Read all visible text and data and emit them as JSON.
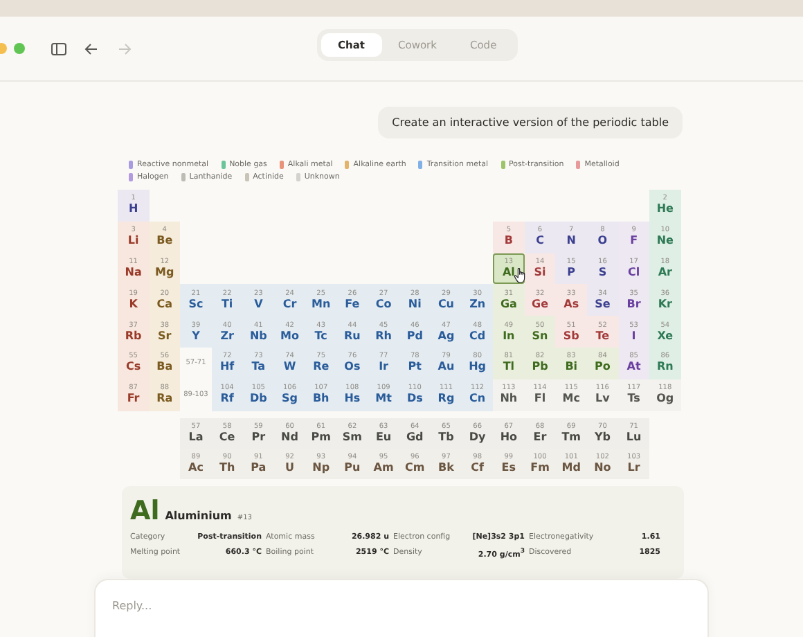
{
  "toolbar": {
    "tabs": [
      {
        "label": "Chat",
        "selected": true
      },
      {
        "label": "Cowork",
        "selected": false
      },
      {
        "label": "Code",
        "selected": false
      }
    ],
    "forward_disabled": true
  },
  "message": "Create an interactive version of the periodic table",
  "legend": [
    {
      "kind": "nonmetal",
      "label": "Reactive nonmetal",
      "color": "#a99be0"
    },
    {
      "kind": "noble",
      "label": "Noble gas",
      "color": "#6cc49a"
    },
    {
      "kind": "alkali",
      "label": "Alkali metal",
      "color": "#e8937a"
    },
    {
      "kind": "alkaline",
      "label": "Alkaline earth",
      "color": "#e3b36a"
    },
    {
      "kind": "transition",
      "label": "Transition metal",
      "color": "#7fb0e6"
    },
    {
      "kind": "post",
      "label": "Post-transition",
      "color": "#9cc46a"
    },
    {
      "kind": "metalloid",
      "label": "Metalloid",
      "color": "#e89a9a"
    },
    {
      "kind": "halogen",
      "label": "Halogen",
      "color": "#b39ae0"
    },
    {
      "kind": "lanthanide",
      "label": "Lanthanide",
      "color": "#bdbdb5"
    },
    {
      "kind": "actinide",
      "label": "Actinide",
      "color": "#c9c4b8"
    },
    {
      "kind": "unknown",
      "label": "Unknown",
      "color": "#d4d2cc"
    }
  ],
  "table": {
    "periods": [
      [
        {
          "n": "1",
          "s": "H",
          "kind": "nonmetal",
          "selected": false
        },
        {
          "n": "2",
          "s": "He",
          "kind": "noble",
          "selected": false
        }
      ],
      [
        {
          "n": "3",
          "s": "Li",
          "kind": "alkali",
          "selected": false
        },
        {
          "n": "4",
          "s": "Be",
          "kind": "alkaline",
          "selected": false
        },
        {
          "n": "5",
          "s": "B",
          "kind": "metalloid",
          "selected": false
        },
        {
          "n": "6",
          "s": "C",
          "kind": "nonmetal",
          "selected": false
        },
        {
          "n": "7",
          "s": "N",
          "kind": "nonmetal",
          "selected": false
        },
        {
          "n": "8",
          "s": "O",
          "kind": "nonmetal",
          "selected": false
        },
        {
          "n": "9",
          "s": "F",
          "kind": "halogen",
          "selected": false
        },
        {
          "n": "10",
          "s": "Ne",
          "kind": "noble",
          "selected": false
        }
      ],
      [
        {
          "n": "11",
          "s": "Na",
          "kind": "alkali",
          "selected": false
        },
        {
          "n": "12",
          "s": "Mg",
          "kind": "alkaline",
          "selected": false
        },
        {
          "n": "13",
          "s": "Al",
          "kind": "post",
          "selected": true
        },
        {
          "n": "14",
          "s": "Si",
          "kind": "metalloid",
          "selected": false
        },
        {
          "n": "15",
          "s": "P",
          "kind": "nonmetal",
          "selected": false
        },
        {
          "n": "16",
          "s": "S",
          "kind": "nonmetal",
          "selected": false
        },
        {
          "n": "17",
          "s": "Cl",
          "kind": "halogen",
          "selected": false
        },
        {
          "n": "18",
          "s": "Ar",
          "kind": "noble",
          "selected": false
        }
      ],
      [
        {
          "n": "19",
          "s": "K",
          "kind": "alkali",
          "selected": false
        },
        {
          "n": "20",
          "s": "Ca",
          "kind": "alkaline",
          "selected": false
        },
        {
          "n": "21",
          "s": "Sc",
          "kind": "transition",
          "selected": false
        },
        {
          "n": "22",
          "s": "Ti",
          "kind": "transition",
          "selected": false
        },
        {
          "n": "23",
          "s": "V",
          "kind": "transition",
          "selected": false
        },
        {
          "n": "24",
          "s": "Cr",
          "kind": "transition",
          "selected": false
        },
        {
          "n": "25",
          "s": "Mn",
          "kind": "transition",
          "selected": false
        },
        {
          "n": "26",
          "s": "Fe",
          "kind": "transition",
          "selected": false
        },
        {
          "n": "27",
          "s": "Co",
          "kind": "transition",
          "selected": false
        },
        {
          "n": "28",
          "s": "Ni",
          "kind": "transition",
          "selected": false
        },
        {
          "n": "29",
          "s": "Cu",
          "kind": "transition",
          "selected": false
        },
        {
          "n": "30",
          "s": "Zn",
          "kind": "transition",
          "selected": false
        },
        {
          "n": "31",
          "s": "Ga",
          "kind": "post",
          "selected": false
        },
        {
          "n": "32",
          "s": "Ge",
          "kind": "metalloid",
          "selected": false
        },
        {
          "n": "33",
          "s": "As",
          "kind": "metalloid",
          "selected": false
        },
        {
          "n": "34",
          "s": "Se",
          "kind": "nonmetal",
          "selected": false
        },
        {
          "n": "35",
          "s": "Br",
          "kind": "halogen",
          "selected": false
        },
        {
          "n": "36",
          "s": "Kr",
          "kind": "noble",
          "selected": false
        }
      ],
      [
        {
          "n": "37",
          "s": "Rb",
          "kind": "alkali",
          "selected": false
        },
        {
          "n": "38",
          "s": "Sr",
          "kind": "alkaline",
          "selected": false
        },
        {
          "n": "39",
          "s": "Y",
          "kind": "transition",
          "selected": false
        },
        {
          "n": "40",
          "s": "Zr",
          "kind": "transition",
          "selected": false
        },
        {
          "n": "41",
          "s": "Nb",
          "kind": "transition",
          "selected": false
        },
        {
          "n": "42",
          "s": "Mo",
          "kind": "transition",
          "selected": false
        },
        {
          "n": "43",
          "s": "Tc",
          "kind": "transition",
          "selected": false
        },
        {
          "n": "44",
          "s": "Ru",
          "kind": "transition",
          "selected": false
        },
        {
          "n": "45",
          "s": "Rh",
          "kind": "transition",
          "selected": false
        },
        {
          "n": "46",
          "s": "Pd",
          "kind": "transition",
          "selected": false
        },
        {
          "n": "47",
          "s": "Ag",
          "kind": "transition",
          "selected": false
        },
        {
          "n": "48",
          "s": "Cd",
          "kind": "transition",
          "selected": false
        },
        {
          "n": "49",
          "s": "In",
          "kind": "post",
          "selected": false
        },
        {
          "n": "50",
          "s": "Sn",
          "kind": "post",
          "selected": false
        },
        {
          "n": "51",
          "s": "Sb",
          "kind": "metalloid",
          "selected": false
        },
        {
          "n": "52",
          "s": "Te",
          "kind": "metalloid",
          "selected": false
        },
        {
          "n": "53",
          "s": "I",
          "kind": "halogen",
          "selected": false
        },
        {
          "n": "54",
          "s": "Xe",
          "kind": "noble",
          "selected": false
        }
      ],
      [
        {
          "n": "55",
          "s": "Cs",
          "kind": "alkali",
          "selected": false
        },
        {
          "n": "56",
          "s": "Ba",
          "kind": "alkaline",
          "selected": false
        },
        {
          "kind": "range",
          "label": "57-71"
        },
        {
          "n": "72",
          "s": "Hf",
          "kind": "transition",
          "selected": false
        },
        {
          "n": "73",
          "s": "Ta",
          "kind": "transition",
          "selected": false
        },
        {
          "n": "74",
          "s": "W",
          "kind": "transition",
          "selected": false
        },
        {
          "n": "75",
          "s": "Re",
          "kind": "transition",
          "selected": false
        },
        {
          "n": "76",
          "s": "Os",
          "kind": "transition",
          "selected": false
        },
        {
          "n": "77",
          "s": "Ir",
          "kind": "transition",
          "selected": false
        },
        {
          "n": "78",
          "s": "Pt",
          "kind": "transition",
          "selected": false
        },
        {
          "n": "79",
          "s": "Au",
          "kind": "transition",
          "selected": false
        },
        {
          "n": "80",
          "s": "Hg",
          "kind": "transition",
          "selected": false
        },
        {
          "n": "81",
          "s": "Tl",
          "kind": "post",
          "selected": false
        },
        {
          "n": "82",
          "s": "Pb",
          "kind": "post",
          "selected": false
        },
        {
          "n": "83",
          "s": "Bi",
          "kind": "post",
          "selected": false
        },
        {
          "n": "84",
          "s": "Po",
          "kind": "post",
          "selected": false
        },
        {
          "n": "85",
          "s": "At",
          "kind": "halogen",
          "selected": false
        },
        {
          "n": "86",
          "s": "Rn",
          "kind": "noble",
          "selected": false
        }
      ],
      [
        {
          "n": "87",
          "s": "Fr",
          "kind": "alkali",
          "selected": false
        },
        {
          "n": "88",
          "s": "Ra",
          "kind": "alkaline",
          "selected": false
        },
        {
          "kind": "range",
          "label": "89-103"
        },
        {
          "n": "104",
          "s": "Rf",
          "kind": "transition",
          "selected": false
        },
        {
          "n": "105",
          "s": "Db",
          "kind": "transition",
          "selected": false
        },
        {
          "n": "106",
          "s": "Sg",
          "kind": "transition",
          "selected": false
        },
        {
          "n": "107",
          "s": "Bh",
          "kind": "transition",
          "selected": false
        },
        {
          "n": "108",
          "s": "Hs",
          "kind": "transition",
          "selected": false
        },
        {
          "n": "109",
          "s": "Mt",
          "kind": "transition",
          "selected": false
        },
        {
          "n": "110",
          "s": "Ds",
          "kind": "transition",
          "selected": false
        },
        {
          "n": "111",
          "s": "Rg",
          "kind": "transition",
          "selected": false
        },
        {
          "n": "112",
          "s": "Cn",
          "kind": "transition",
          "selected": false
        },
        {
          "n": "113",
          "s": "Nh",
          "kind": "unknown",
          "selected": false
        },
        {
          "n": "114",
          "s": "Fl",
          "kind": "unknown",
          "selected": false
        },
        {
          "n": "115",
          "s": "Mc",
          "kind": "unknown",
          "selected": false
        },
        {
          "n": "116",
          "s": "Lv",
          "kind": "unknown",
          "selected": false
        },
        {
          "n": "117",
          "s": "Ts",
          "kind": "unknown",
          "selected": false
        },
        {
          "n": "118",
          "s": "Og",
          "kind": "unknown",
          "selected": false
        }
      ]
    ],
    "f_block": [
      [
        {
          "n": "57",
          "s": "La",
          "kind": "lanthanide",
          "selected": false
        },
        {
          "n": "58",
          "s": "Ce",
          "kind": "lanthanide",
          "selected": false
        },
        {
          "n": "59",
          "s": "Pr",
          "kind": "lanthanide",
          "selected": false
        },
        {
          "n": "60",
          "s": "Nd",
          "kind": "lanthanide",
          "selected": false
        },
        {
          "n": "61",
          "s": "Pm",
          "kind": "lanthanide",
          "selected": false
        },
        {
          "n": "62",
          "s": "Sm",
          "kind": "lanthanide",
          "selected": false
        },
        {
          "n": "63",
          "s": "Eu",
          "kind": "lanthanide",
          "selected": false
        },
        {
          "n": "64",
          "s": "Gd",
          "kind": "lanthanide",
          "selected": false
        },
        {
          "n": "65",
          "s": "Tb",
          "kind": "lanthanide",
          "selected": false
        },
        {
          "n": "66",
          "s": "Dy",
          "kind": "lanthanide",
          "selected": false
        },
        {
          "n": "67",
          "s": "Ho",
          "kind": "lanthanide",
          "selected": false
        },
        {
          "n": "68",
          "s": "Er",
          "kind": "lanthanide",
          "selected": false
        },
        {
          "n": "69",
          "s": "Tm",
          "kind": "lanthanide",
          "selected": false
        },
        {
          "n": "70",
          "s": "Yb",
          "kind": "lanthanide",
          "selected": false
        },
        {
          "n": "71",
          "s": "Lu",
          "kind": "lanthanide",
          "selected": false
        }
      ],
      [
        {
          "n": "89",
          "s": "Ac",
          "kind": "actinide",
          "selected": false
        },
        {
          "n": "90",
          "s": "Th",
          "kind": "actinide",
          "selected": false
        },
        {
          "n": "91",
          "s": "Pa",
          "kind": "actinide",
          "selected": false
        },
        {
          "n": "92",
          "s": "U",
          "kind": "actinide",
          "selected": false
        },
        {
          "n": "93",
          "s": "Np",
          "kind": "actinide",
          "selected": false
        },
        {
          "n": "94",
          "s": "Pu",
          "kind": "actinide",
          "selected": false
        },
        {
          "n": "95",
          "s": "Am",
          "kind": "actinide",
          "selected": false
        },
        {
          "n": "96",
          "s": "Cm",
          "kind": "actinide",
          "selected": false
        },
        {
          "n": "97",
          "s": "Bk",
          "kind": "actinide",
          "selected": false
        },
        {
          "n": "98",
          "s": "Cf",
          "kind": "actinide",
          "selected": false
        },
        {
          "n": "99",
          "s": "Es",
          "kind": "actinide",
          "selected": false
        },
        {
          "n": "100",
          "s": "Fm",
          "kind": "actinide",
          "selected": false
        },
        {
          "n": "101",
          "s": "Md",
          "kind": "actinide",
          "selected": false
        },
        {
          "n": "102",
          "s": "No",
          "kind": "actinide",
          "selected": false
        },
        {
          "n": "103",
          "s": "Lr",
          "kind": "actinide",
          "selected": false
        }
      ]
    ]
  },
  "detail": {
    "symbol": "Al",
    "name": "Aluminium",
    "number": "#13",
    "kind": "post",
    "properties": [
      {
        "label": "Category",
        "value": "Post-transition"
      },
      {
        "label": "Atomic mass",
        "value": "26.982 u"
      },
      {
        "label": "Electron config",
        "value": "[Ne]3s2 3p1"
      },
      {
        "label": "Electronegativity",
        "value": "1.61"
      },
      {
        "label": "Melting point",
        "value": "660.3 °C"
      },
      {
        "label": "Boiling point",
        "value": "2519 °C"
      },
      {
        "label": "Density",
        "value": "2.70 g/cm$^{3}$"
      },
      {
        "label": "Discovered",
        "value": "1825"
      }
    ]
  },
  "reply": {
    "placeholder": "Reply..."
  }
}
